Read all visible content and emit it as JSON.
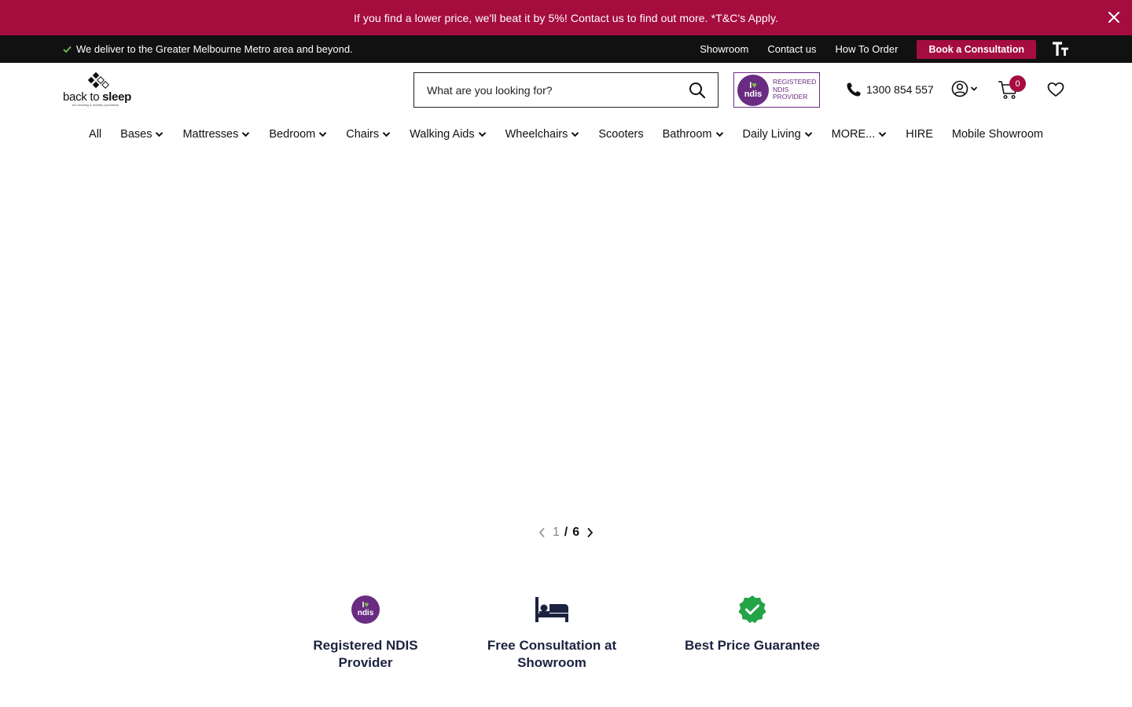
{
  "promo": {
    "text": "If you find a lower price, we'll beat it by 5%!  Contact us to find out more. *T&C's Apply."
  },
  "utility": {
    "delivery_text": "We deliver to the Greater Melbourne Metro area and beyond.",
    "links": [
      "Showroom",
      "Contact us",
      "How To Order"
    ],
    "book_label": "Book a Consultation",
    "text_size_icon": "text-size-icon"
  },
  "header": {
    "logo": {
      "text_regular": "back to ",
      "text_bold": "sleep",
      "tagline": "the bedding & mobility specialists"
    },
    "search": {
      "placeholder": "What are you looking for?"
    },
    "ndis_badge": {
      "circle_top": "I",
      "circle_bottom": "ndis",
      "line1": "REGISTERED",
      "line2": "NDIS",
      "line3": "PROVIDER"
    },
    "phone": "1300 854 557",
    "cart_count": "0"
  },
  "nav": {
    "items": [
      {
        "label": "All",
        "has_dropdown": false
      },
      {
        "label": "Bases",
        "has_dropdown": true
      },
      {
        "label": "Mattresses",
        "has_dropdown": true
      },
      {
        "label": "Bedroom",
        "has_dropdown": true
      },
      {
        "label": "Chairs",
        "has_dropdown": true
      },
      {
        "label": "Walking Aids",
        "has_dropdown": true
      },
      {
        "label": "Wheelchairs",
        "has_dropdown": true
      },
      {
        "label": "Scooters",
        "has_dropdown": false
      },
      {
        "label": "Bathroom",
        "has_dropdown": true
      },
      {
        "label": "Daily Living",
        "has_dropdown": true
      },
      {
        "label": "MORE...",
        "has_dropdown": true
      },
      {
        "label": "HIRE",
        "has_dropdown": false
      },
      {
        "label": "Mobile Showroom",
        "has_dropdown": false
      }
    ]
  },
  "slider": {
    "current": "1",
    "separator": "/",
    "total": "6"
  },
  "features": [
    {
      "icon": "ndis-icon",
      "label": "Registered NDIS Provider"
    },
    {
      "icon": "bed-icon",
      "label": "Free Consultation at Showroom"
    },
    {
      "icon": "verified-check-icon",
      "label": "Best Price Guarantee"
    }
  ],
  "colors": {
    "brand": "#a50d3f",
    "utility_bar": "#111111",
    "ndis_purple": "#6a2c82",
    "feature_text": "#1c2340",
    "check_green": "#22a447"
  }
}
